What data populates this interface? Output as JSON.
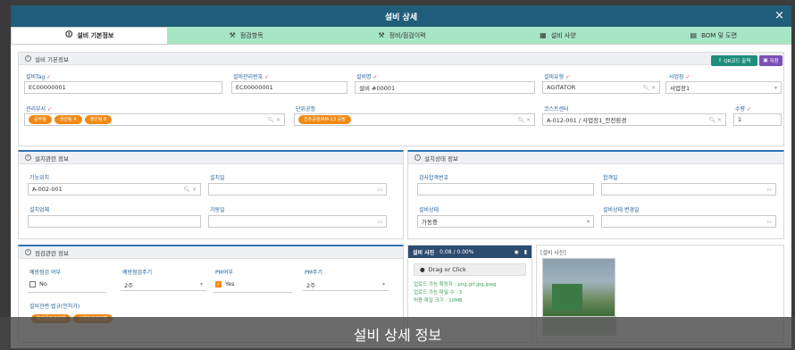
{
  "modal": {
    "title": "설비 상세",
    "close": "×"
  },
  "tabs": [
    {
      "icon": "🛈",
      "label": "설비 기본정보"
    },
    {
      "icon": "⚒",
      "label": "점검항목"
    },
    {
      "icon": "⚒",
      "label": "정비/점검이력"
    },
    {
      "icon": "▦",
      "label": "설비 사양"
    },
    {
      "icon": "▤",
      "label": "BOM 및 도면"
    }
  ],
  "basic": {
    "header": "설비 기본정보",
    "qr_button": "QR코드 출력",
    "save_button": "저장",
    "equip_tag_label": "설비Tag",
    "equip_tag_value": "EC00000001",
    "mgmt_no_label": "설비관리번호",
    "mgmt_no_value": "EC00000001",
    "equip_name_label": "설비명",
    "equip_name_value": "설비 #00001",
    "equip_type_label": "설비유형",
    "equip_type_value": "AGITATOR",
    "site_label": "사업장",
    "site_value": "사업장1",
    "dept_label": "관리부서",
    "dept_chips": [
      "공무팀",
      "생산팀 A",
      "생산팀 B"
    ],
    "process_label": "단위공정",
    "process_chip": "건조공정/RM-13 공정",
    "cost_center_label": "코스트센터",
    "cost_center_value": "A-012-001 / 사업장1_안전환경",
    "qty_label": "수량",
    "qty_value": "1"
  },
  "install": {
    "header": "설치관련 정보",
    "func_loc_label": "기능위치",
    "func_loc_value": "A-002-001",
    "install_date_label": "설치일",
    "installer_label": "설치업체",
    "operation_date_label": "가동일"
  },
  "status": {
    "header": "설치상태 정보",
    "inspection_no_label": "검사합격번호",
    "pass_date_label": "합격일",
    "equip_status_label": "설비상태",
    "equip_status_value": "가동중",
    "status_change_label": "설비상태 변경일"
  },
  "inspect": {
    "header": "점검관련 정보",
    "preventive_label": "예방점검 여부",
    "preventive_value": "No",
    "preventive_cycle_label": "예방점검주기",
    "preventive_cycle_value": "2주",
    "pm_label": "PM여부",
    "pm_value": "Yes",
    "pm_cycle_label": "PM주기",
    "pm_cycle_value": "2주",
    "law_label": "설비관련 법규(인허가)",
    "law_chips": [
      "화학물질관리법",
      "산업안전보건법"
    ]
  },
  "photo": {
    "header": "설비 사진",
    "size": "0.08 / 0.00%",
    "drop": "Drag or Click",
    "ext_info": "업로드 가능 확장자 : png,gif,jpg,jpeg",
    "count_info": "업로드 가능 파일 수 : 5",
    "size_info": "허용 파일 크기 : 10MB",
    "preview_label": "[설비 사진]"
  },
  "caption": "설비 상세 정보",
  "colors": {
    "title_bar": "#1f5d7a",
    "tab_bg": "#a7e6c4",
    "chip": "#f08a14",
    "qr_btn": "#1e8e7e",
    "save_btn": "#7b4fb3"
  }
}
